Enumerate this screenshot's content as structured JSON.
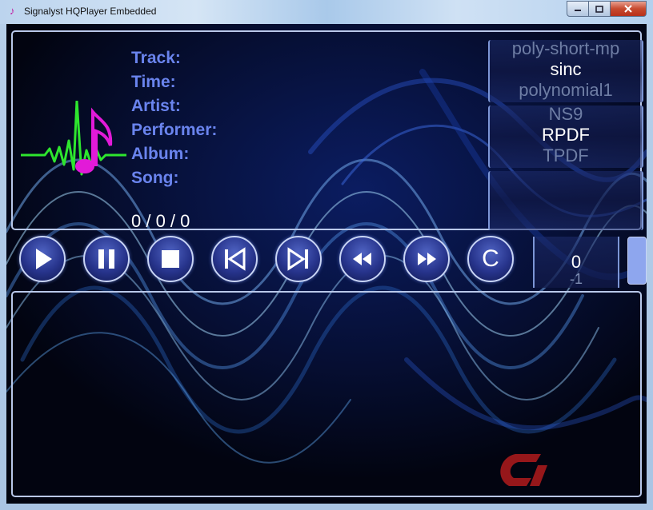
{
  "window": {
    "title": "Signalyst HQPlayer Embedded",
    "icon": "music-note-icon",
    "controls": {
      "minimize": "minimize-icon",
      "maximize": "maximize-icon",
      "close": "close-icon"
    }
  },
  "track_info": {
    "labels": [
      "Track:",
      "Time:",
      "Artist:",
      "Performer:",
      "Album:",
      "Song:"
    ],
    "counter": "0 / 0 / 0"
  },
  "filter": {
    "prev": "poly-short-mp",
    "current": "sinc",
    "next": "polynomial1"
  },
  "shaper": {
    "prev": "NS9",
    "current": "RPDF",
    "next": "TPDF"
  },
  "transport": {
    "buttons": [
      {
        "name": "play",
        "icon": "play-icon"
      },
      {
        "name": "pause",
        "icon": "pause-icon"
      },
      {
        "name": "stop",
        "icon": "stop-icon"
      },
      {
        "name": "previous",
        "icon": "skip-back-icon"
      },
      {
        "name": "next",
        "icon": "skip-forward-icon"
      },
      {
        "name": "rewind",
        "icon": "rewind-icon"
      },
      {
        "name": "fast-forward",
        "icon": "fast-forward-icon"
      },
      {
        "name": "clear",
        "label": "C"
      }
    ]
  },
  "volume": {
    "current": "0",
    "next": "-1"
  },
  "colors": {
    "label_blue": "#6a84ee",
    "button_fill": "#27348c",
    "panel_border": "#b9c8ea",
    "logo_green": "#2ee62e",
    "logo_magenta": "#e21ad8"
  }
}
